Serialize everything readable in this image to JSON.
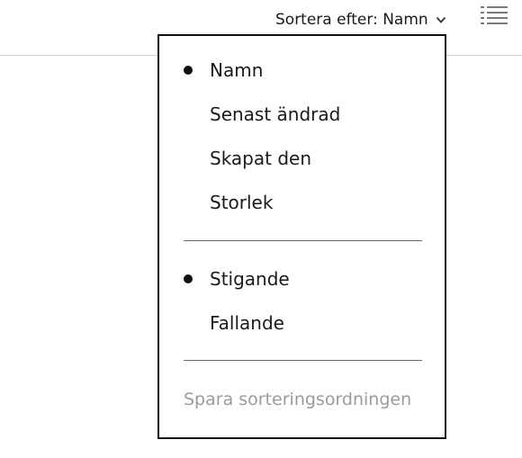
{
  "sort_trigger": {
    "prefix": "Sortera efter:",
    "value": "Namn"
  },
  "view_toggle": {
    "icon": "list-view-icon"
  },
  "sort_menu": {
    "sort_by_options": [
      {
        "label": "Namn",
        "selected": true
      },
      {
        "label": "Senast ändrad",
        "selected": false
      },
      {
        "label": "Skapat den",
        "selected": false
      },
      {
        "label": "Storlek",
        "selected": false
      }
    ],
    "order_options": [
      {
        "label": "Stigande",
        "selected": true
      },
      {
        "label": "Fallande",
        "selected": false
      }
    ],
    "save_label": "Spara sorteringsordningen"
  }
}
